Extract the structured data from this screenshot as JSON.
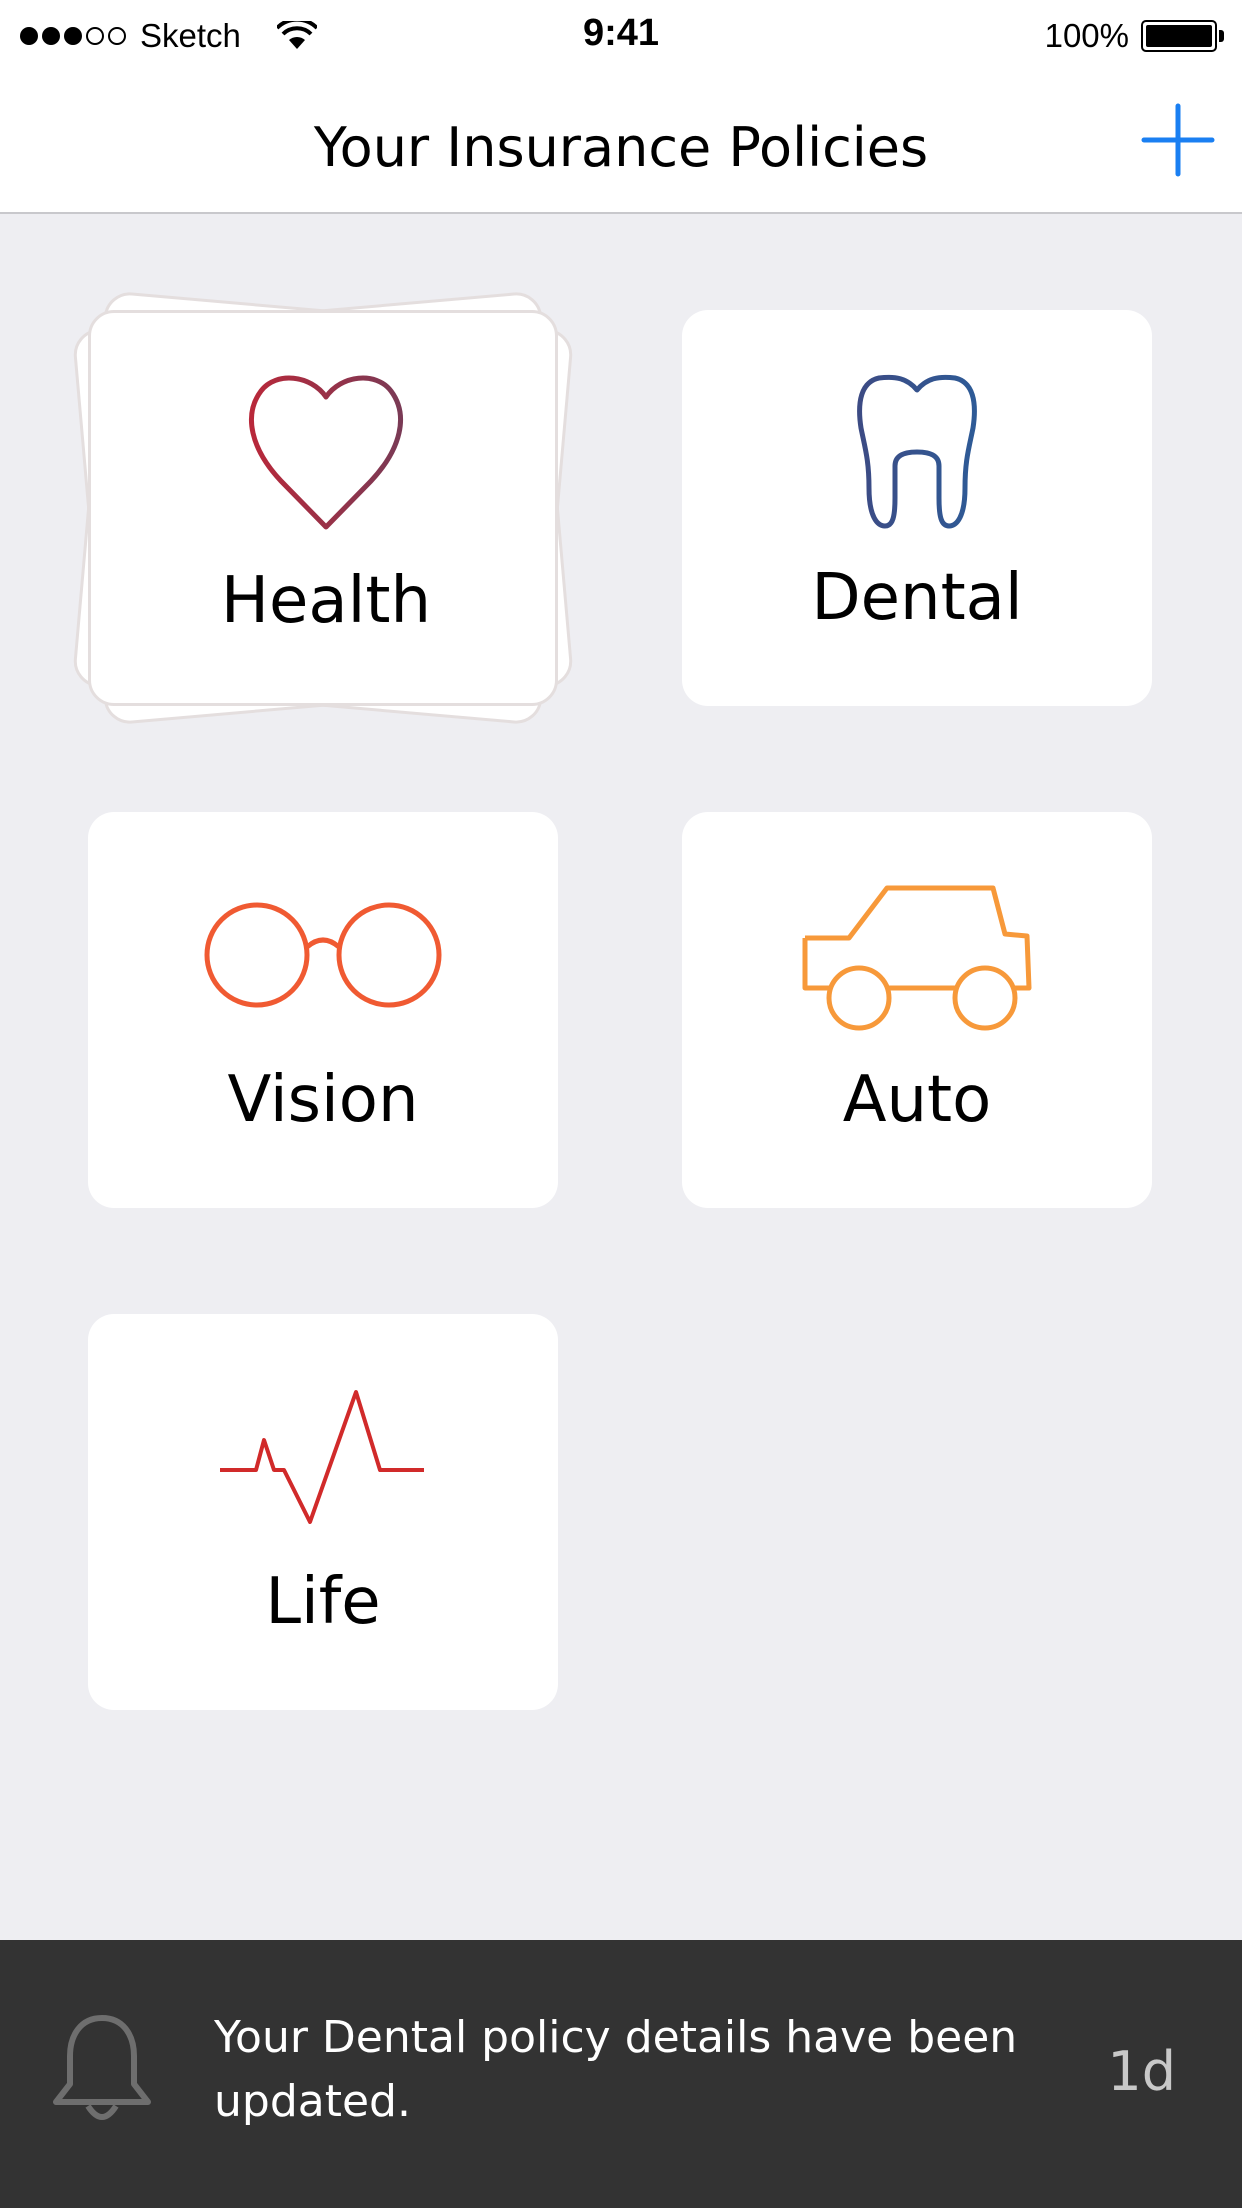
{
  "status_bar": {
    "carrier": "Sketch",
    "time": "9:41",
    "battery": "100%"
  },
  "header": {
    "title": "Your Insurance Policies",
    "add_icon": "plus-icon"
  },
  "policies": [
    {
      "label": "Health",
      "icon": "heart-icon",
      "color": "#b0283a"
    },
    {
      "label": "Dental",
      "icon": "tooth-icon",
      "color": "#3b4f8a"
    },
    {
      "label": "Vision",
      "icon": "glasses-icon",
      "color": "#f05a32"
    },
    {
      "label": "Auto",
      "icon": "car-icon",
      "color": "#f7993a"
    },
    {
      "label": "Life",
      "icon": "heartbeat-icon",
      "color": "#d12a2a"
    }
  ],
  "notification": {
    "icon": "bell-icon",
    "message": "Your Dental policy details have been updated.",
    "time": "1d"
  },
  "colors": {
    "accent": "#1a7ff2",
    "background": "#eeeef2",
    "banner": "#333333"
  }
}
